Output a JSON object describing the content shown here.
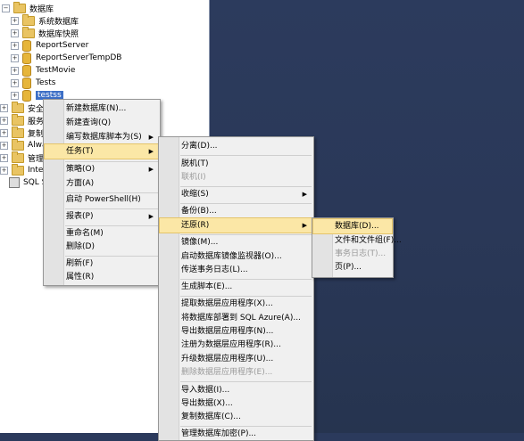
{
  "tree": {
    "items": [
      {
        "label": "数据库",
        "icon": "folder-icon"
      },
      {
        "label": "系统数据库",
        "icon": "folder-icon"
      },
      {
        "label": "数据库快照",
        "icon": "folder-icon"
      },
      {
        "label": "ReportServer",
        "icon": "database-icon"
      },
      {
        "label": "ReportServerTempDB",
        "icon": "database-icon"
      },
      {
        "label": "TestMovie",
        "icon": "database-icon"
      },
      {
        "label": "Tests",
        "icon": "database-icon"
      },
      {
        "label": "testss",
        "icon": "database-icon"
      },
      {
        "label": "安全性",
        "icon": "folder-icon"
      },
      {
        "label": "服务器",
        "icon": "folder-icon"
      },
      {
        "label": "复制",
        "icon": "folder-icon"
      },
      {
        "label": "Alway",
        "icon": "folder-icon"
      },
      {
        "label": "管理",
        "icon": "folder-icon"
      },
      {
        "label": "Integ",
        "icon": "folder-icon"
      },
      {
        "label": "SQL S",
        "icon": "sql-agent-icon"
      }
    ]
  },
  "context_menu": {
    "items": [
      "新建数据库(N)...",
      "新建查询(Q)",
      "编写数据库脚本为(S)",
      "任务(T)",
      "策略(O)",
      "方面(A)",
      "启动 PowerShell(H)",
      "报表(P)",
      "重命名(M)",
      "删除(D)",
      "刷新(F)",
      "属性(R)"
    ]
  },
  "tasks_menu": {
    "items": [
      "分离(D)...",
      "脱机(T)",
      "联机(I)",
      "收缩(S)",
      "备份(B)...",
      "还原(R)",
      "镜像(M)...",
      "启动数据库镜像监视器(O)...",
      "传送事务日志(L)...",
      "生成脚本(E)...",
      "提取数据层应用程序(X)...",
      "将数据库部署到 SQL Azure(A)...",
      "导出数据层应用程序(N)...",
      "注册为数据层应用程序(R)...",
      "升级数据层应用程序(U)...",
      "删除数据层应用程序(E)...",
      "导入数据(I)...",
      "导出数据(X)...",
      "复制数据库(C)...",
      "管理数据库加密(P)..."
    ]
  },
  "restore_menu": {
    "items": [
      "数据库(D)...",
      "文件和文件组(F)...",
      "事务日志(T)...",
      "页(P)..."
    ]
  },
  "colors": {
    "desktop": "#2b3a5c",
    "highlight": "#fbe7a6",
    "selection": "#3d6fc6"
  }
}
